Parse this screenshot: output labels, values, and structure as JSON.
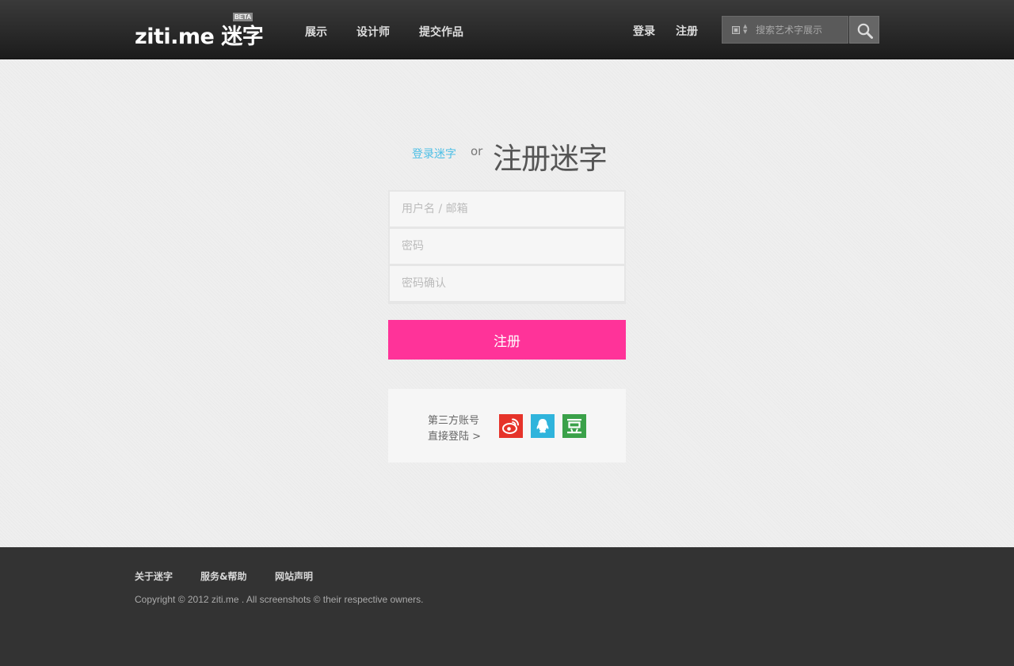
{
  "header": {
    "logo_text": "ziti.me 迷字",
    "logo_badge": "BETA",
    "nav": [
      "展示",
      "设计师",
      "提交作品"
    ],
    "login_label": "登录",
    "register_label": "注册",
    "search": {
      "type_icon": "square-select-icon",
      "placeholder": "搜索艺术字展示",
      "button_icon": "search-icon"
    }
  },
  "main": {
    "switch_login_label": "登录迷字",
    "or_text": "or",
    "title": "注册迷字",
    "fields": {
      "username_placeholder": "用户名 / 邮箱",
      "password_placeholder": "密码",
      "confirm_placeholder": "密码确认"
    },
    "submit_label": "注册",
    "third_party": {
      "line1": "第三方账号",
      "line2": "直接登陆 >",
      "providers": [
        {
          "name": "weibo",
          "icon": "weibo-icon",
          "color": "#e6332a"
        },
        {
          "name": "qq",
          "icon": "qq-icon",
          "color": "#2fb4dc"
        },
        {
          "name": "douban",
          "icon": "douban-icon",
          "color": "#3aa149"
        }
      ]
    }
  },
  "footer": {
    "links": [
      "关于迷字",
      "服务&帮助",
      "网站声明"
    ],
    "copyright": "Copyright © 2012 ziti.me . All screenshots © their respective owners."
  },
  "colors": {
    "accent_pink": "#ff3399",
    "link_blue": "#4cbfe6",
    "header_dark": "#262626",
    "footer_dark": "#333333"
  }
}
